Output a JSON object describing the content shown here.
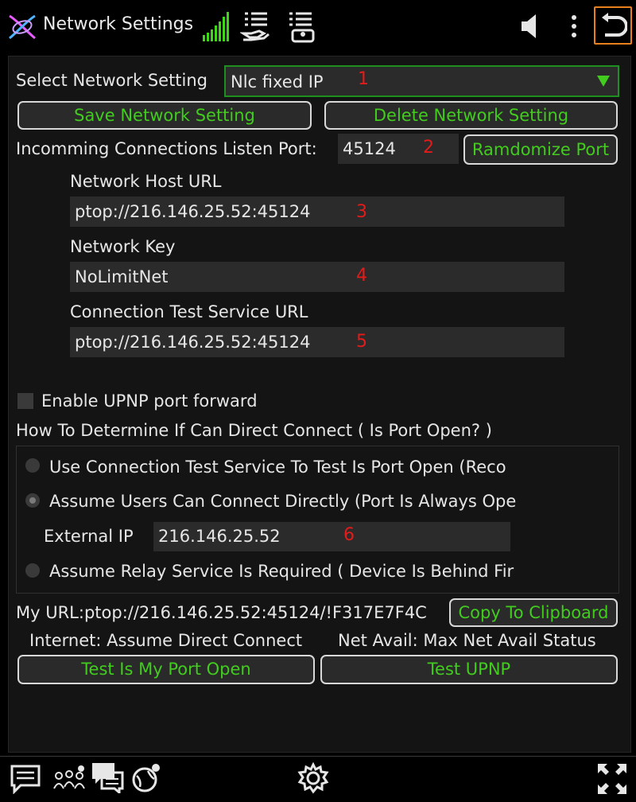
{
  "header": {
    "title": "Network Settings",
    "icons": {
      "logo": "app-logo-icon",
      "signal": "signal-bars-icon",
      "list_hand": "list-hand-icon",
      "list_person": "list-person-icon",
      "speaker": "speaker-icon",
      "more": "more-vertical-icon",
      "back": "back-icon"
    }
  },
  "network": {
    "select_label": "Select Network Setting",
    "selected_setting": "Nlc fixed IP",
    "marker_1": "1",
    "save_button": "Save Network Setting",
    "delete_button": "Delete Network Setting",
    "listen_port_label": "Incomming Connections Listen Port:",
    "listen_port_value": "45124",
    "marker_2": "2",
    "randomize_button": "Ramdomize Port",
    "host_url_label": "Network Host URL",
    "host_url_value": "ptop://216.146.25.52:45124",
    "marker_3": "3",
    "key_label": "Network Key",
    "key_value": "NoLimitNet",
    "marker_4": "4",
    "test_service_label": "Connection Test Service URL",
    "test_service_value": "ptop://216.146.25.52:45124",
    "marker_5": "5"
  },
  "upnp": {
    "enable_label": "Enable UPNP port forward",
    "checked": false
  },
  "direct_connect": {
    "heading": "How To Determine If Can Direct Connect ( Is Port Open? )",
    "option_1": "Use Connection Test Service To Test Is Port Open (Reco",
    "option_2": "Assume Users Can Connect Directly (Port Is Always Ope",
    "option_3": "Assume Relay Service Is Required ( Device Is Behind Fir",
    "selected_option": 2,
    "external_ip_label": "External IP",
    "external_ip_value": "216.146.25.52",
    "marker_6": "6"
  },
  "status": {
    "my_url_label": "My URL:",
    "my_url_value": "ptop://216.146.25.52:45124/!F317E7F4C",
    "copy_button": "Copy To Clipboard",
    "internet_status": "Internet: Assume Direct Connect",
    "net_avail_status": "Net Avail: Max Net Avail Status",
    "test_port_button": "Test Is My Port Open",
    "test_upnp_button": "Test UPNP"
  },
  "footer": {
    "icons": [
      "chat-icon",
      "people-icon",
      "messages-icon",
      "globe-person-icon",
      "settings-gear-icon",
      "fullscreen-icon"
    ]
  },
  "colors": {
    "accent_green": "#41cc1e",
    "marker_red": "#e31b1b",
    "back_border": "#e8801e",
    "background": "#000000",
    "panel": "#141414"
  }
}
